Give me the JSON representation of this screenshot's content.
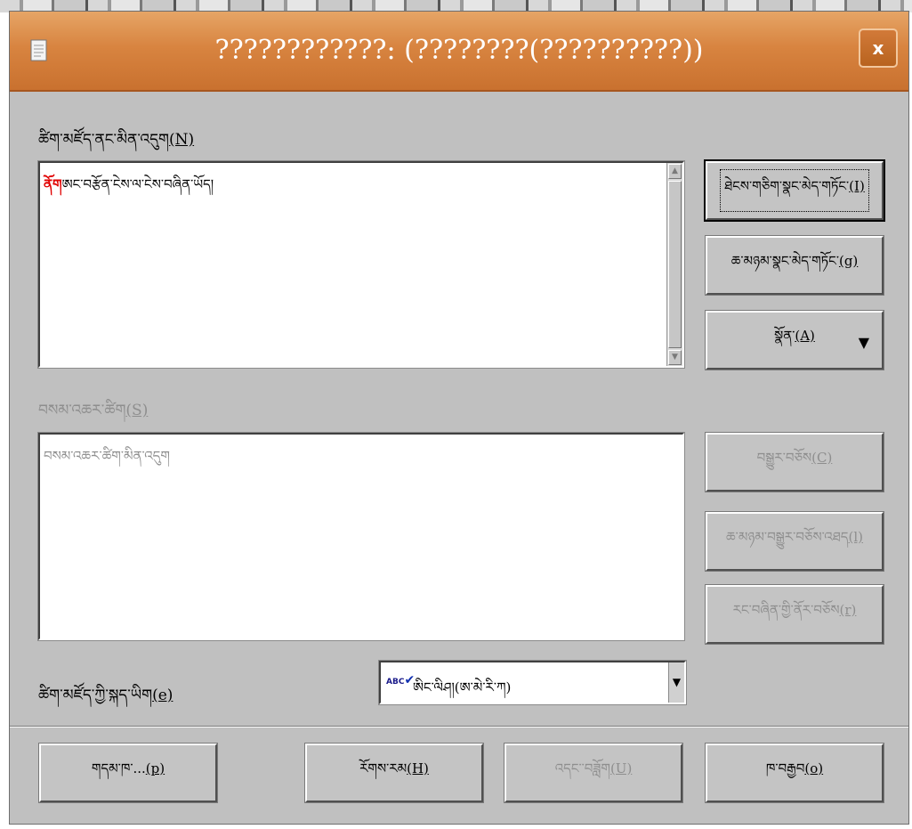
{
  "window": {
    "title": "????????????: (????????(??????????))",
    "close_label": "x"
  },
  "main": {
    "not_in_dictionary_label_text": "ཚིག་མཛོད་ནང་མིན་འདུག",
    "not_in_dictionary_label_key": "(N)",
    "text_content_error_word": "ནོག",
    "text_content_rest": "ཨང་བརྩོན་ངེས་ལ་ངེས་བཞིན་ཡོད།",
    "suggestions_label_text": "བསམ་འཆར་ཚིག",
    "suggestions_label_key": "(S)",
    "suggestions_placeholder": "བསམ་འཆར་ཚིག་མིན་འདུག",
    "dictionary_language_label_text": "ཚིག་མཛོད་ཀྱི་སྐད་ཡིག",
    "dictionary_language_label_key": "(e)",
    "language_value": "ཨིང་ལིཤ།(ཨ་མེ་རི་ཀ)"
  },
  "buttons": {
    "ignore_once": {
      "text": "ཐེངས་གཅིག་སྣང་མེད་གཏོང་",
      "key": "(I)"
    },
    "ignore_all": {
      "text": "ཆ་མཉམ་སྣང་མེད་གཏོང་",
      "key": "(g)"
    },
    "add": {
      "text": "སྣོན་",
      "key": "(A)"
    },
    "change": {
      "text": "བསྒྱུར་བཅོས",
      "key": "(C)"
    },
    "change_all": {
      "text": "ཆ་མཉམ་བསྒྱུར་བཅོས་འཐད",
      "key": "(l)"
    },
    "autocorrect": {
      "text": "རང་བཞིན་གྱི་ནོར་བཅོས",
      "key": "(r)"
    },
    "options": {
      "text": "གདམ་ཁ་...",
      "key": "(p)"
    },
    "help": {
      "text": "རོགས་རམ",
      "key": "(H)"
    },
    "undo": {
      "text": "འདང་་བཟློག",
      "key": "(U)"
    },
    "close": {
      "text": "ཁ་བརྒྱབ",
      "key": "(o)"
    }
  },
  "icons": {
    "title": "document-icon",
    "dropdown": "triangle-down-icon",
    "spellcheck": "abc-check-icon"
  },
  "colors": {
    "titlebar": "#d88440",
    "error_text": "#e00000",
    "dialog_bg": "#c0c0c0"
  }
}
